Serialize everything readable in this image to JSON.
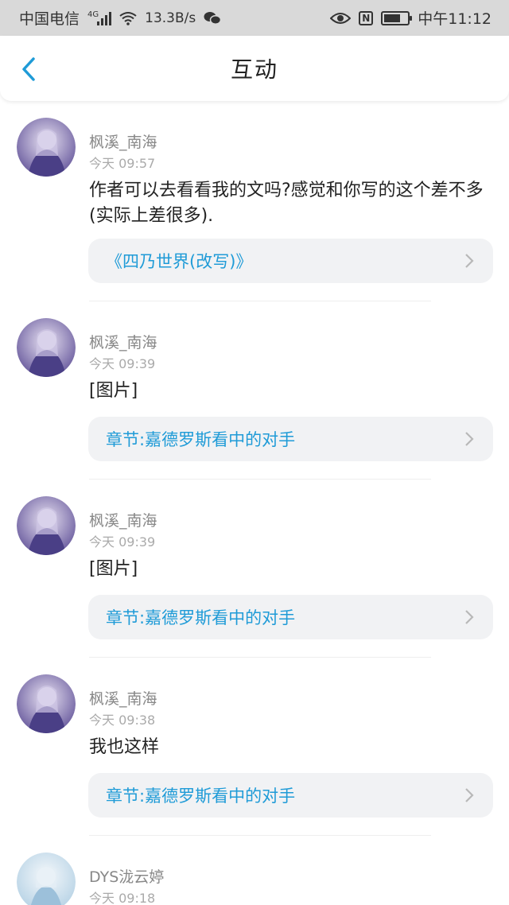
{
  "status_bar": {
    "carrier": "中国电信",
    "network_tag": "4G",
    "speed": "13.3B/s",
    "nfc_letter": "N",
    "time": "中午11:12",
    "battery_level": 0.7
  },
  "header": {
    "title": "互动",
    "back_icon": "chevron-left-icon"
  },
  "posts": [
    {
      "user": "枫溪_南海",
      "time": "今天 09:57",
      "text": "作者可以去看看我的文吗?感觉和你写的这个差不多(实际上差很多).",
      "link": "《四乃世界(改写)》"
    },
    {
      "user": "枫溪_南海",
      "time": "今天 09:39",
      "text": "[图片]",
      "link": "章节:嘉德罗斯看中的对手"
    },
    {
      "user": "枫溪_南海",
      "time": "今天 09:39",
      "text": "[图片]",
      "link": "章节:嘉德罗斯看中的对手"
    },
    {
      "user": "枫溪_南海",
      "time": "今天 09:38",
      "text": "我也这样",
      "link": "章节:嘉德罗斯看中的对手"
    },
    {
      "user": "DYS泷云婷",
      "time": "今天 09:18"
    }
  ],
  "colors": {
    "accent": "#1f9bd7",
    "status_bar_bg": "#d9d9d9",
    "card_bg": "#f1f2f4"
  }
}
